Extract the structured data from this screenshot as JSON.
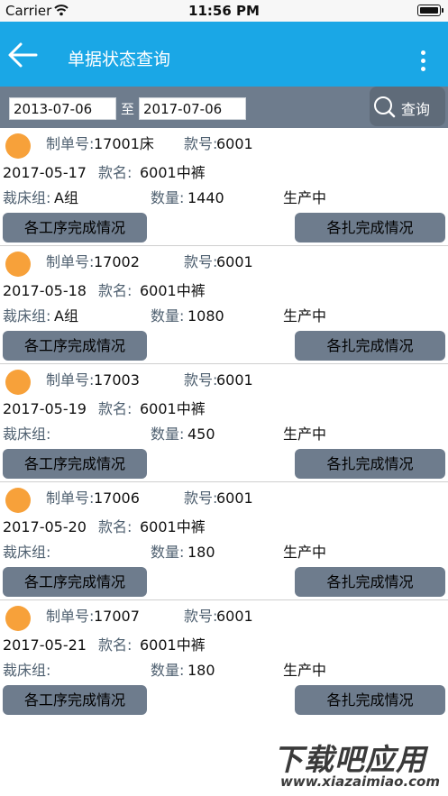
{
  "status_bar": {
    "carrier": "Carrier",
    "time": "11:56 PM"
  },
  "nav": {
    "title": "单据状态查询"
  },
  "search": {
    "date_from": "2013-07-06",
    "date_to": "2017-07-06",
    "to_label": "至",
    "button_label": "查询"
  },
  "labels": {
    "order_no": "制单号:",
    "style_no": "款号:",
    "style_name": "款名:",
    "cut_group": "裁床组:",
    "quantity": "数量:",
    "process_button": "各工序完成情况",
    "bundle_button": "各扎完成情况"
  },
  "orders": [
    {
      "order_no": "17001床",
      "style_no": "6001",
      "date": "2017-05-17",
      "style_name": "6001中裤",
      "cut_group": "A组",
      "quantity": "1440",
      "status": "生产中"
    },
    {
      "order_no": "17002",
      "style_no": "6001",
      "date": "2017-05-18",
      "style_name": "6001中裤",
      "cut_group": "A组",
      "quantity": "1080",
      "status": "生产中"
    },
    {
      "order_no": "17003",
      "style_no": "6001",
      "date": "2017-05-19",
      "style_name": "6001中裤",
      "cut_group": "",
      "quantity": "450",
      "status": "生产中"
    },
    {
      "order_no": "17006",
      "style_no": "6001",
      "date": "2017-05-20",
      "style_name": "6001中裤",
      "cut_group": "",
      "quantity": "180",
      "status": "生产中"
    },
    {
      "order_no": "17007",
      "style_no": "6001",
      "date": "2017-05-21",
      "style_name": "6001中裤",
      "cut_group": "",
      "quantity": "180",
      "status": "生产中"
    }
  ],
  "watermark": {
    "main": "下载吧应用",
    "sub": "www.xiazaimiao.com"
  },
  "colors": {
    "nav": "#1aa7e6",
    "toolbar": "#6e7c8d",
    "dot": "#f7a13a"
  }
}
